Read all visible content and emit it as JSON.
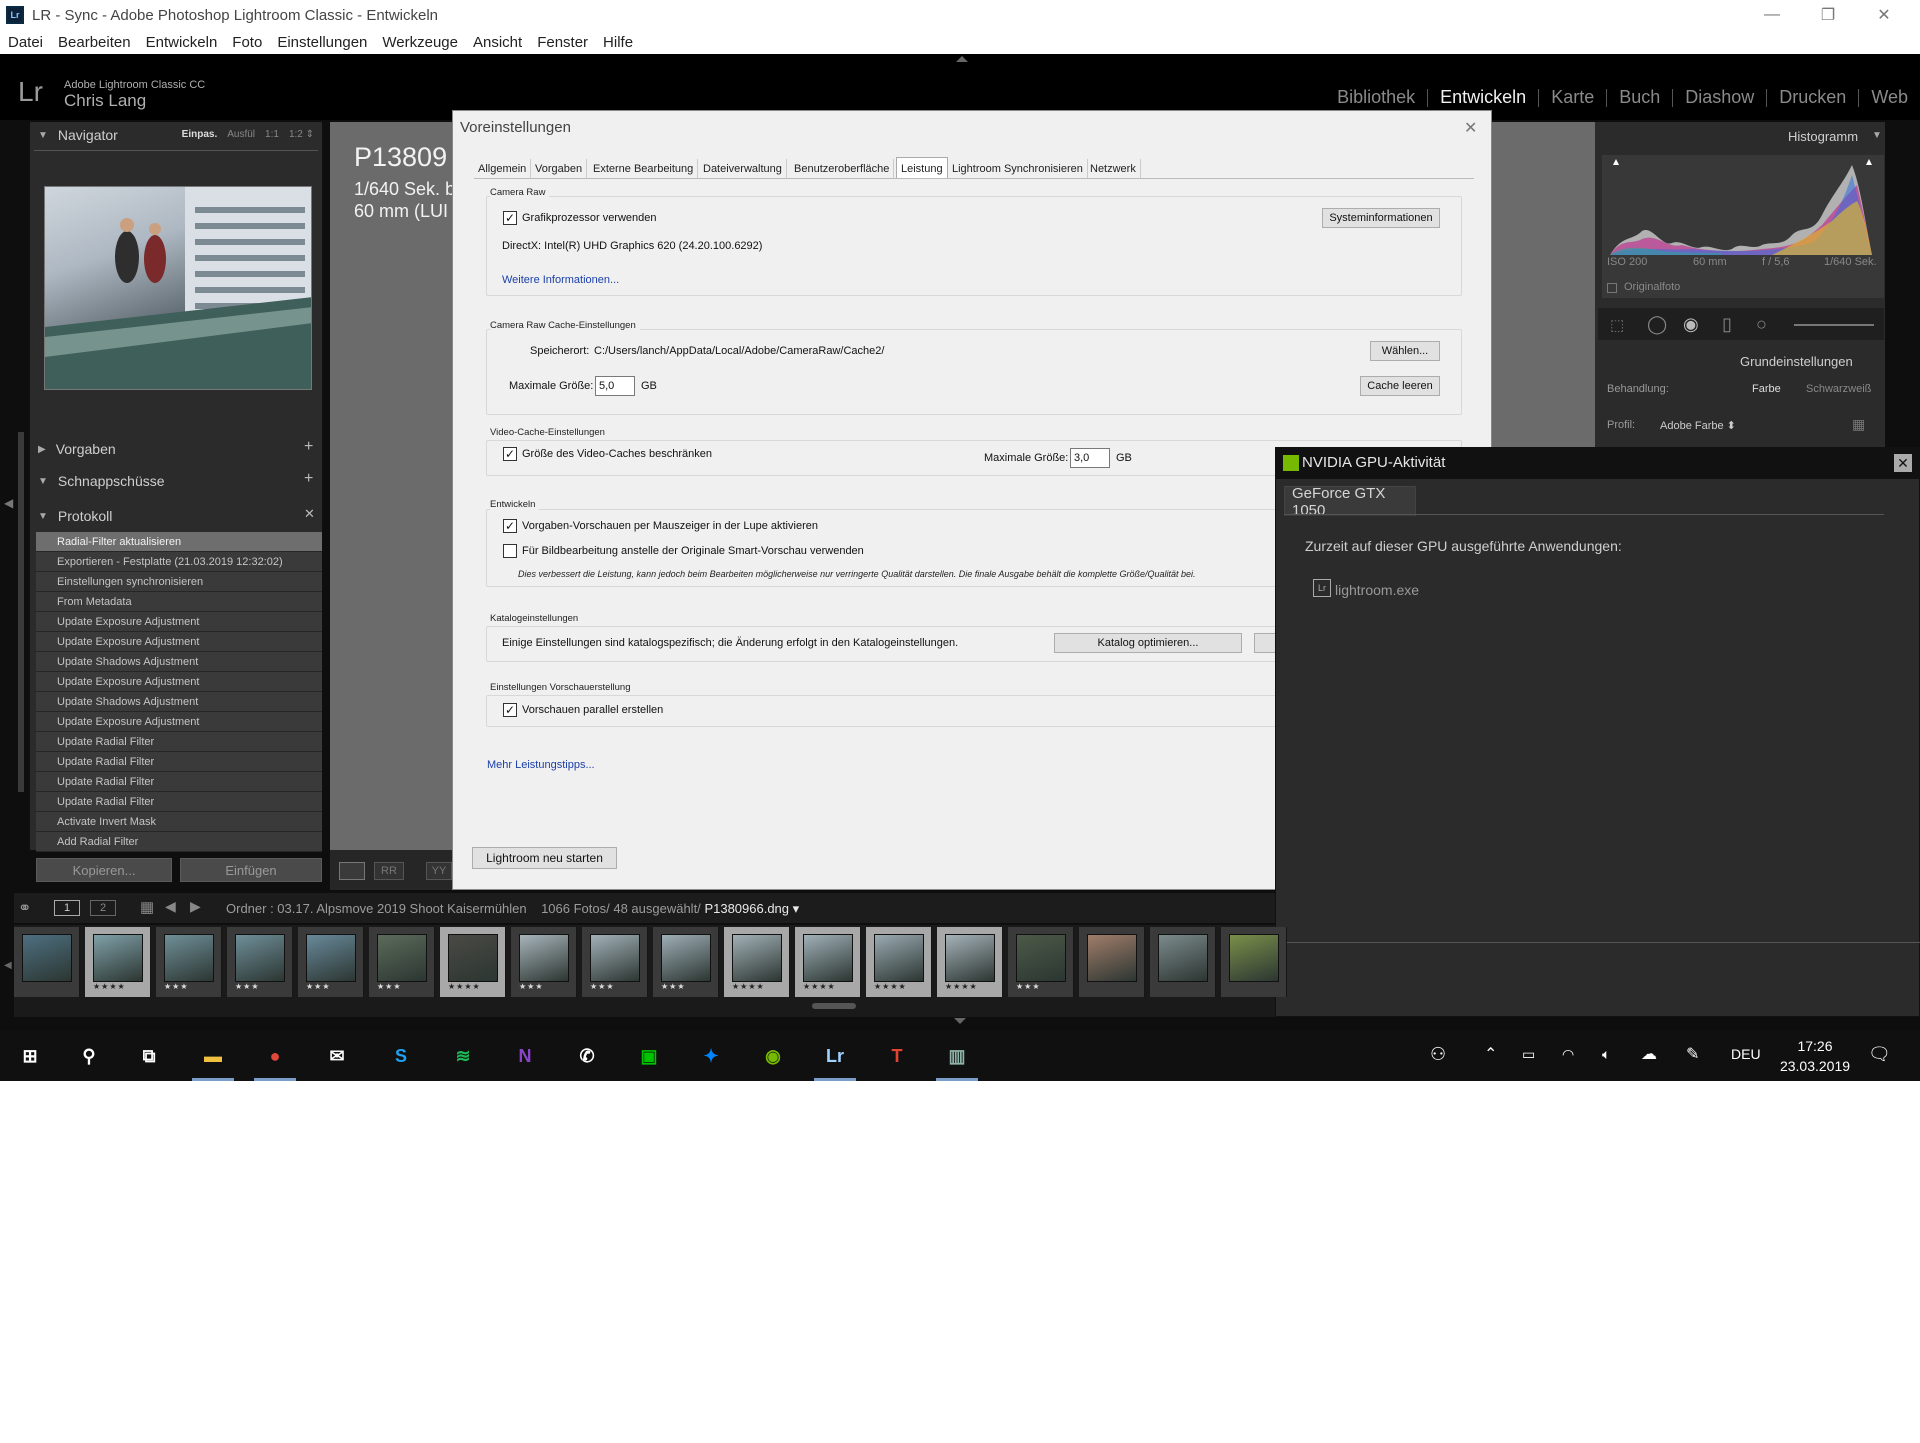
{
  "window": {
    "title": "LR - Sync - Adobe Photoshop Lightroom Classic - Entwickeln",
    "logo_text": "Lr",
    "controls": [
      "—",
      "❐",
      "✕"
    ]
  },
  "menubar": [
    "Datei",
    "Bearbeiten",
    "Entwickeln",
    "Foto",
    "Einstellungen",
    "Werkzeuge",
    "Ansicht",
    "Fenster",
    "Hilfe"
  ],
  "identity": {
    "logo": "Lr",
    "app": "Adobe Lightroom Classic CC",
    "user": "Chris Lang"
  },
  "modules": [
    {
      "label": "Bibliothek",
      "active": false
    },
    {
      "label": "Entwickeln",
      "active": true
    },
    {
      "label": "Karte",
      "active": false
    },
    {
      "label": "Buch",
      "active": false
    },
    {
      "label": "Diashow",
      "active": false
    },
    {
      "label": "Drucken",
      "active": false
    },
    {
      "label": "Web",
      "active": false
    }
  ],
  "left_panel": {
    "navigator": {
      "title": "Navigator",
      "zoom": [
        "Einpas.",
        "Ausfül",
        "1:1",
        "1:2 ⇕"
      ]
    },
    "presets": "Vorgaben",
    "snapshots": "Schnappschüsse",
    "history_title": "Protokoll",
    "history": [
      "Radial-Filter aktualisieren",
      "Exportieren - Festplatte (21.03.2019 12:32:02)",
      "Einstellungen synchronisieren",
      "From Metadata",
      "Update Exposure Adjustment",
      "Update Exposure Adjustment",
      "Update Shadows Adjustment",
      "Update Exposure Adjustment",
      "Update Shadows Adjustment",
      "Update Exposure Adjustment",
      "Update Radial Filter",
      "Update Radial Filter",
      "Update Radial Filter",
      "Update Radial Filter",
      "Activate Invert Mask",
      "Add Radial Filter"
    ],
    "copy_button": "Kopieren...",
    "paste_button": "Einfügen"
  },
  "center_info": {
    "filename": "P13809",
    "line1": "1/640 Sek. b",
    "line2": "60 mm (LUI"
  },
  "right_panel": {
    "histogram_title": "Histogramm",
    "hist_labels": [
      "ISO 200",
      "60 mm",
      "f / 5,6",
      "1/640 Sek."
    ],
    "original_photo": "Originalfoto",
    "basic_title": "Grundeinstellungen",
    "treatment_label": "Behandlung:",
    "treatment_color": "Farbe",
    "treatment_bw": "Schwarzweiß",
    "profile_label": "Profil:",
    "profile_value": "Adobe Farbe ⬍"
  },
  "dialog": {
    "title": "Voreinstellungen",
    "close": "✕",
    "tabs": [
      "Allgemein",
      "Vorgaben",
      "Externe Bearbeitung",
      "Dateiverwaltung",
      "Benutzeroberfläche",
      "Leistung",
      "Lightroom Synchronisieren",
      "Netzwerk"
    ],
    "active_tab": "Leistung",
    "camera_raw": {
      "group": "Camera Raw",
      "gpu_label": "Grafikprozessor verwenden",
      "gpu_checked": true,
      "sysinfo_button": "Systeminformationen",
      "directx": "DirectX: Intel(R) UHD Graphics 620 (24.20.100.6292)",
      "more_info": "Weitere Informationen..."
    },
    "cache": {
      "group": "Camera Raw Cache-Einstellungen",
      "location_label": "Speicherort:",
      "location_value": "C:/Users/lanch/AppData/Local/Adobe/CameraRaw/Cache2/",
      "choose_button": "Wählen...",
      "max_label": "Maximale Größe:",
      "max_value": "5,0",
      "unit": "GB",
      "purge_button": "Cache leeren"
    },
    "video_cache": {
      "group": "Video-Cache-Einstellungen",
      "limit_label": "Größe des Video-Caches beschränken",
      "limit_checked": true,
      "max_label": "Maximale Größe:",
      "max_value": "3,0",
      "unit": "GB"
    },
    "develop": {
      "group": "Entwickeln",
      "hover_label": "Vorgaben-Vorschauen per Mauszeiger in der Lupe aktivieren",
      "hover_checked": true,
      "smart_label": "Für Bildbearbeitung anstelle der Originale Smart-Vorschau verwenden",
      "smart_checked": false,
      "note": "Dies verbessert die Leistung, kann jedoch beim Bearbeiten möglicherweise nur verringerte Qualität darstellen. Die finale Ausgabe behält die komplette Größe/Qualität bei."
    },
    "catalog": {
      "group": "Katalogeinstellungen",
      "text": "Einige Einstellungen sind katalogspezifisch; die Änderung erfolgt in den Katalogeinstellungen.",
      "optimize_button": "Katalog optimieren..."
    },
    "preview": {
      "group": "Einstellungen Vorschauerstellung",
      "parallel_label": "Vorschauen parallel erstellen",
      "parallel_checked": true
    },
    "more_tips": "Mehr Leistungstipps...",
    "restart_button": "Lightroom neu starten"
  },
  "nvidia": {
    "title": "NVIDIA GPU-Aktivität",
    "close": "✕",
    "gpu_tab": "GeForce GTX 1050",
    "subtitle": "Zurzeit auf dieser GPU ausgeführte Anwendungen:",
    "app_icon": "Lr",
    "app": "lightroom.exe"
  },
  "filmstrip": {
    "views": [
      "1",
      "2"
    ],
    "source": "Ordner : 03.17. Alpsmove 2019 Shoot Kaisermühlen",
    "count": "1066 Fotos/ 48 ausgewählt/",
    "current_file": "P1380966.dng ▾",
    "thumbs": [
      {
        "stars": "",
        "selected": false,
        "tone": "#4d6f80"
      },
      {
        "stars": "★★★★",
        "selected": true,
        "tone": "#7fa0a8"
      },
      {
        "stars": "★★★",
        "selected": false,
        "tone": "#6f8f98"
      },
      {
        "stars": "★★★",
        "selected": false,
        "tone": "#6e8e99"
      },
      {
        "stars": "★★★",
        "selected": false,
        "tone": "#68899a"
      },
      {
        "stars": "★★★",
        "selected": false,
        "tone": "#5b6b5a"
      },
      {
        "stars": "★★★★",
        "selected": true,
        "tone": "#4a4a44"
      },
      {
        "stars": "★★★",
        "selected": false,
        "tone": "#a7b4ba"
      },
      {
        "stars": "★★★",
        "selected": false,
        "tone": "#a3b1b8"
      },
      {
        "stars": "★★★",
        "selected": false,
        "tone": "#9eaeb6"
      },
      {
        "stars": "★★★★",
        "selected": true,
        "tone": "#a2b0b6"
      },
      {
        "stars": "★★★★",
        "selected": true,
        "tone": "#9fb0b7"
      },
      {
        "stars": "★★★★",
        "selected": true,
        "tone": "#9aaab2"
      },
      {
        "stars": "★★★★",
        "selected": true,
        "tone": "#a5b2b8"
      },
      {
        "stars": "★★★",
        "selected": false,
        "tone": "#4c5a48"
      },
      {
        "stars": "",
        "selected": false,
        "tone": "#a07d6a"
      },
      {
        "stars": "",
        "selected": false,
        "tone": "#7c8a8c"
      },
      {
        "stars": "",
        "selected": false,
        "tone": "#7a8f4a"
      }
    ]
  },
  "taskbar": {
    "apps": [
      {
        "name": "start",
        "glyph": "⊞",
        "color": "#ffffff"
      },
      {
        "name": "search",
        "glyph": "⚲",
        "color": "#ffffff"
      },
      {
        "name": "taskview",
        "glyph": "⧉",
        "color": "#ffffff"
      },
      {
        "name": "explorer",
        "glyph": "▬",
        "color": "#f0c040"
      },
      {
        "name": "chrome",
        "glyph": "●",
        "color": "#e0483c"
      },
      {
        "name": "mail",
        "glyph": "✉",
        "color": "#ffffff"
      },
      {
        "name": "skype",
        "glyph": "S",
        "color": "#1da1f2"
      },
      {
        "name": "spotify",
        "glyph": "≋",
        "color": "#1db954"
      },
      {
        "name": "onenote",
        "glyph": "N",
        "color": "#8a44c8"
      },
      {
        "name": "whatsapp",
        "glyph": "✆",
        "color": "#ffffff"
      },
      {
        "name": "line",
        "glyph": "▣",
        "color": "#00c300"
      },
      {
        "name": "messenger",
        "glyph": "✦",
        "color": "#0084ff"
      },
      {
        "name": "nvidia",
        "glyph": "◉",
        "color": "#76b900"
      },
      {
        "name": "lightroom",
        "glyph": "Lr",
        "color": "#9fd2ff"
      },
      {
        "name": "todoist",
        "glyph": "T",
        "color": "#e44332"
      },
      {
        "name": "lr-window",
        "glyph": "▥",
        "color": "#8fb3a8"
      }
    ],
    "language": "DEU",
    "time": "17:26",
    "date": "23.03.2019"
  }
}
